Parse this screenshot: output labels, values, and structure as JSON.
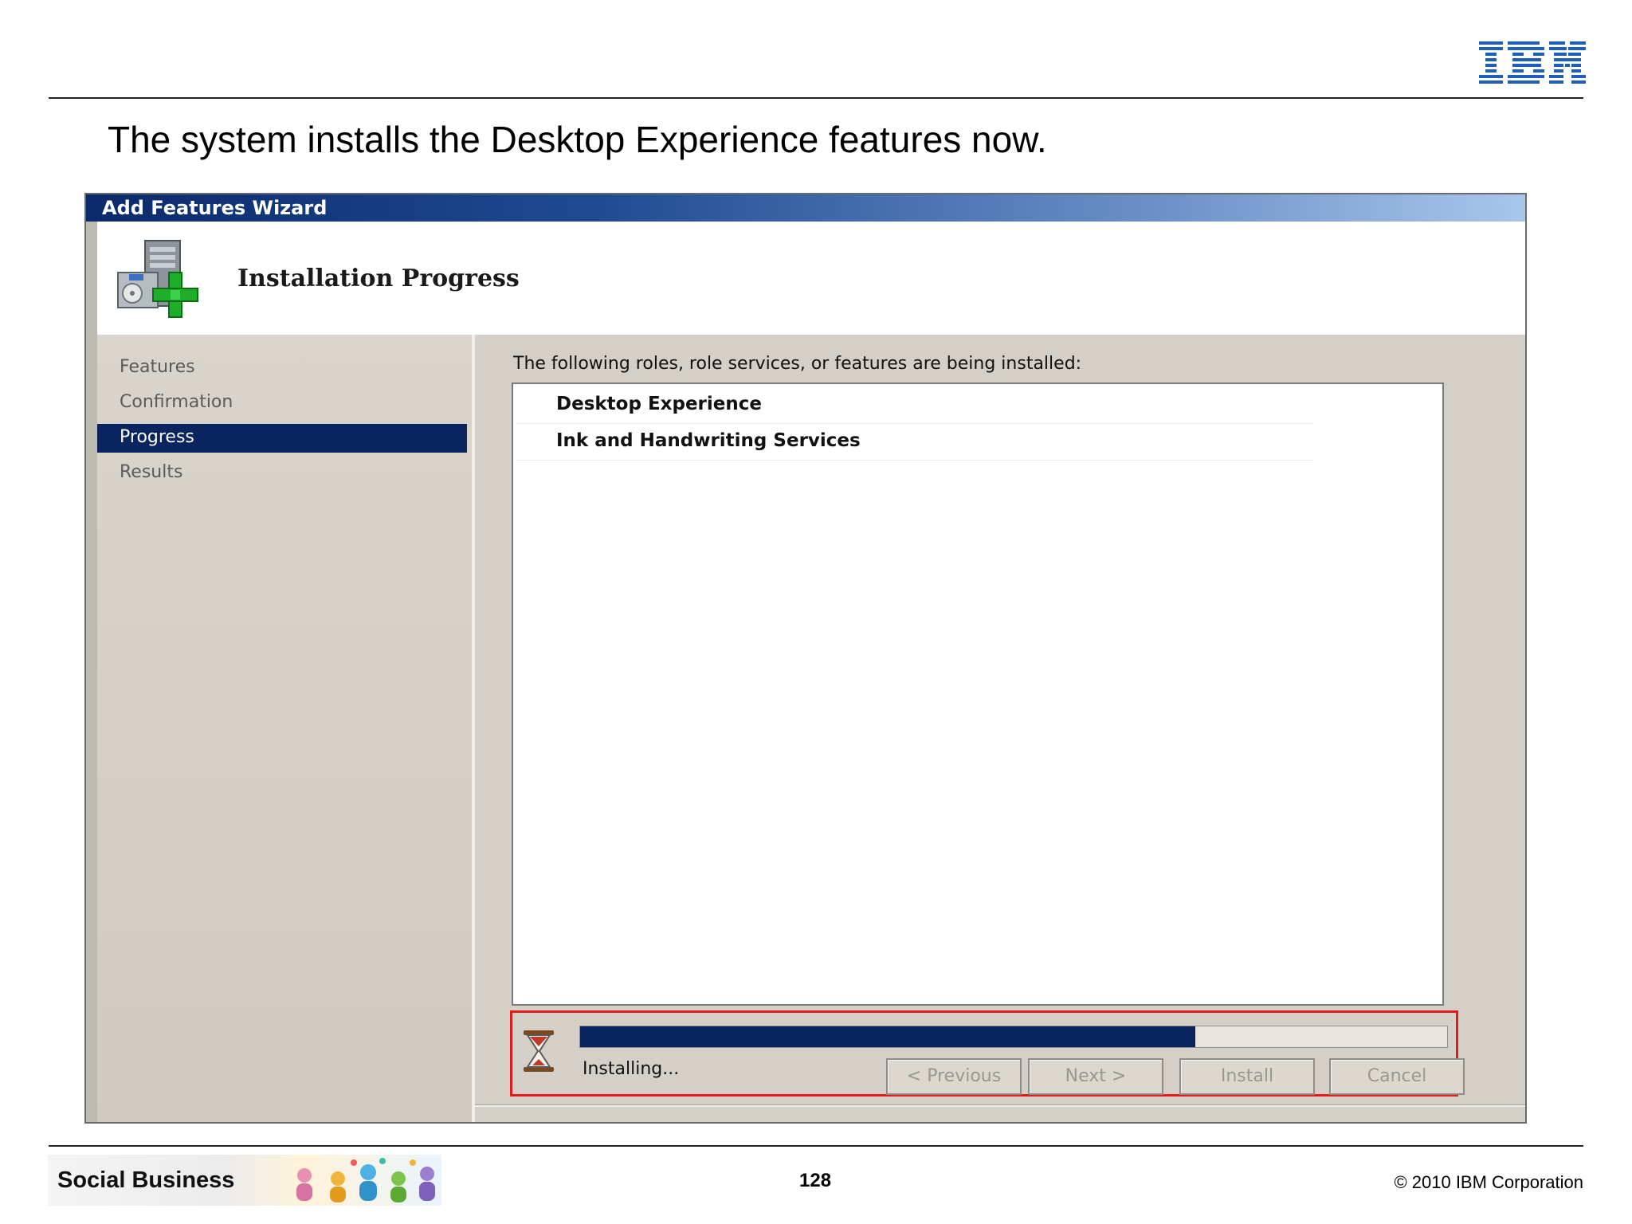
{
  "slide": {
    "title": "The system installs the Desktop Experience features now.",
    "logo": "IBM",
    "footer_label": "Social Business",
    "page_number": "128",
    "copyright": "© 2010 IBM Corporation"
  },
  "wizard": {
    "window_title": "Add Features Wizard",
    "header_title": "Installation Progress",
    "header_icon": "server-install-icon",
    "nav": {
      "items": [
        {
          "label": "Features"
        },
        {
          "label": "Confirmation"
        },
        {
          "label": "Progress"
        },
        {
          "label": "Results"
        }
      ],
      "active_index": 2
    },
    "content": {
      "heading": "The following roles, role services, or features are being installed:",
      "items": [
        {
          "label": "Desktop Experience"
        },
        {
          "label": "Ink and Handwriting Services"
        }
      ],
      "progress": {
        "status": "Installing...",
        "fraction": 0.71,
        "icon": "hourglass-icon"
      }
    },
    "buttons": {
      "previous": "< Previous",
      "next": "Next >",
      "install": "Install",
      "cancel": "Cancel"
    }
  },
  "colors": {
    "selection": "#0a2460",
    "highlight_border": "#e01b1b",
    "window_face": "#d4d0c8",
    "ibm_blue": "#1f5fb8"
  }
}
